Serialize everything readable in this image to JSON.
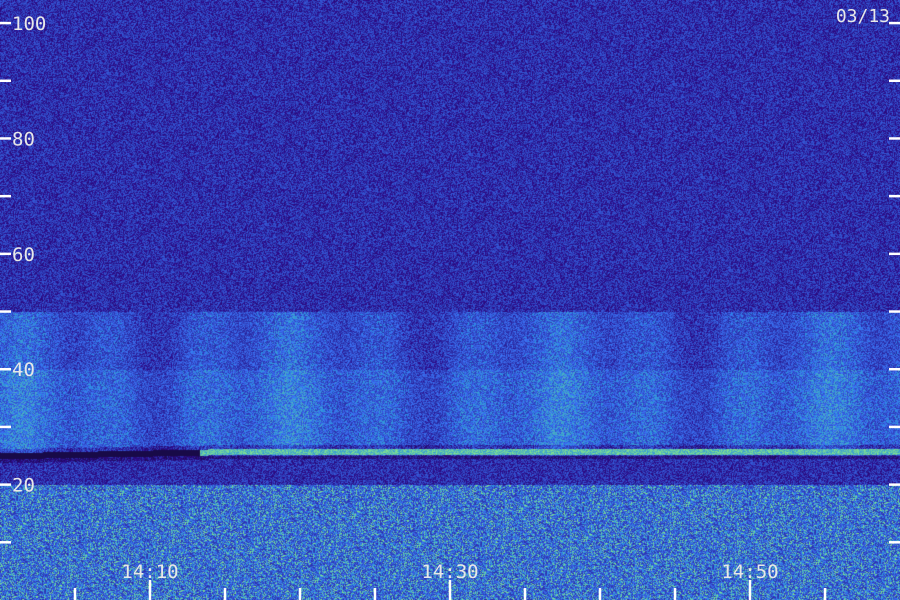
{
  "date_label": "03/13",
  "chart_data": {
    "type": "heatmap",
    "title": "",
    "xlabel": "",
    "ylabel": "",
    "x_start_minutes": 0,
    "x_tick_labels": [
      "14:10",
      "14:30",
      "14:50"
    ],
    "x_ticks_minutes": [
      10,
      30,
      50
    ],
    "x_minor_ticks_minutes": [
      5,
      10,
      15,
      20,
      25,
      30,
      35,
      40,
      45,
      50,
      55
    ],
    "y_tick_labels": [
      "20",
      "40",
      "60",
      "80",
      "100"
    ],
    "y_ticks": [
      20,
      40,
      60,
      80,
      100
    ],
    "y_minor_ticks": [
      10,
      30,
      50,
      70,
      90
    ],
    "ylim": [
      0,
      104
    ],
    "xlim": [
      0,
      60
    ],
    "colors": {
      "background": "#1a1050",
      "noise": "#3020a8",
      "mid": "#2e5cf0",
      "high": "#30e0a0",
      "peak": "#a0ff60"
    },
    "features": [
      {
        "name": "horizontal echo line",
        "y_start": 23,
        "y_end": 25,
        "x_from_minutes": 0
      },
      {
        "name": "enhanced band",
        "y_low": 25,
        "y_high": 50
      }
    ]
  }
}
